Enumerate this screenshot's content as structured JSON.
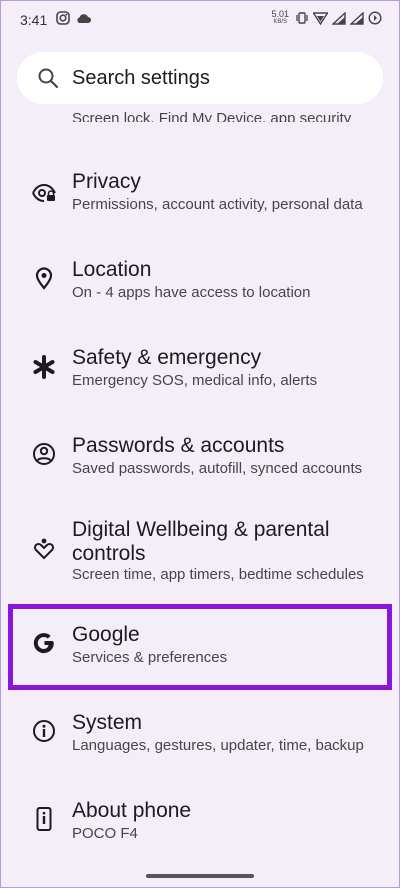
{
  "status_bar": {
    "time": "3:41",
    "net_speed_value": "5.01",
    "net_speed_unit": "KB/S"
  },
  "search": {
    "placeholder": "Search settings"
  },
  "clipped_item_subtitle": "Screen lock, Find My Device, app security",
  "settings": [
    {
      "title": "Privacy",
      "subtitle": "Permissions, account activity, personal data",
      "icon": "privacy-eye-icon"
    },
    {
      "title": "Location",
      "subtitle": "On - 4 apps have access to location",
      "icon": "location-pin-icon"
    },
    {
      "title": "Safety & emergency",
      "subtitle": "Emergency SOS, medical info, alerts",
      "icon": "asterisk-icon"
    },
    {
      "title": "Passwords & accounts",
      "subtitle": "Saved passwords, autofill, synced accounts",
      "icon": "account-circle-icon"
    },
    {
      "title_line1": "Digital Wellbeing & parental",
      "title_line2": "controls",
      "subtitle": "Screen time, app timers, bedtime schedules",
      "icon": "wellbeing-icon"
    },
    {
      "title": "Google",
      "subtitle": "Services & preferences",
      "icon": "google-g-icon"
    },
    {
      "title": "System",
      "subtitle": "Languages, gestures, updater, time, backup",
      "icon": "info-circle-icon"
    },
    {
      "title": "About phone",
      "subtitle": "POCO F4",
      "icon": "phone-info-icon"
    }
  ],
  "colors": {
    "background": "#f4eef8",
    "highlight": "#8b16d9",
    "search_bg": "#ffffff"
  }
}
